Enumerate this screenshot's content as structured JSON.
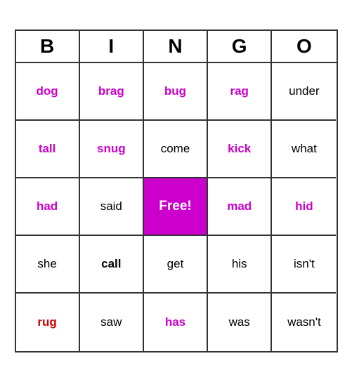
{
  "header": {
    "letters": [
      "B",
      "I",
      "N",
      "G",
      "O"
    ]
  },
  "cells": [
    {
      "text": "dog",
      "style": "bold-purple"
    },
    {
      "text": "brag",
      "style": "bold-purple"
    },
    {
      "text": "bug",
      "style": "bold-purple"
    },
    {
      "text": "rag",
      "style": "bold-purple"
    },
    {
      "text": "under",
      "style": "normal"
    },
    {
      "text": "tall",
      "style": "bold-purple"
    },
    {
      "text": "snug",
      "style": "bold-purple"
    },
    {
      "text": "come",
      "style": "normal"
    },
    {
      "text": "kick",
      "style": "bold-purple"
    },
    {
      "text": "what",
      "style": "normal"
    },
    {
      "text": "had",
      "style": "bold-purple"
    },
    {
      "text": "said",
      "style": "normal"
    },
    {
      "text": "Free!",
      "style": "free-cell"
    },
    {
      "text": "mad",
      "style": "bold-purple"
    },
    {
      "text": "hid",
      "style": "bold-purple"
    },
    {
      "text": "she",
      "style": "normal"
    },
    {
      "text": "call",
      "style": "bold-black"
    },
    {
      "text": "get",
      "style": "normal"
    },
    {
      "text": "his",
      "style": "normal"
    },
    {
      "text": "isn't",
      "style": "normal"
    },
    {
      "text": "rug",
      "style": "red-bold"
    },
    {
      "text": "saw",
      "style": "normal"
    },
    {
      "text": "has",
      "style": "bold-purple"
    },
    {
      "text": "was",
      "style": "normal"
    },
    {
      "text": "wasn't",
      "style": "normal"
    }
  ]
}
